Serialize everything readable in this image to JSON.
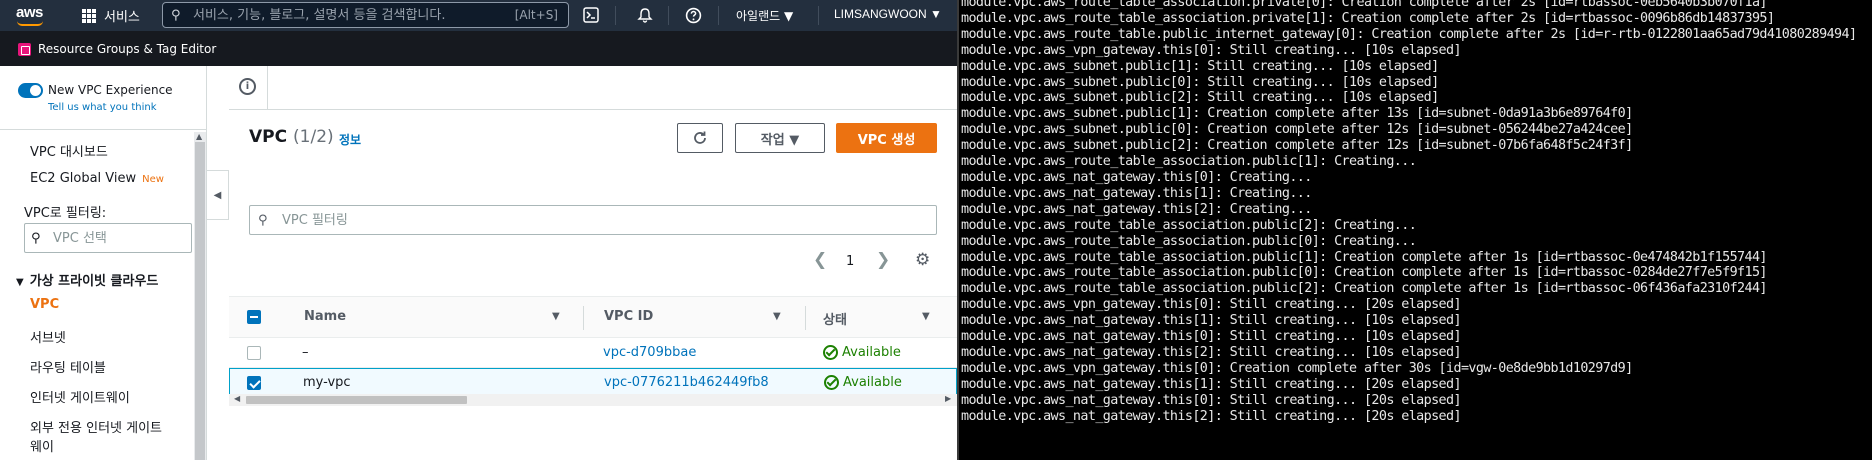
{
  "topnav": {
    "logo": "aws",
    "services_label": "서비스",
    "search_placeholder": "서비스, 기능, 블로그, 설명서 등을 검색합니다.",
    "search_shortcut": "[Alt+S]",
    "region": "아일랜드 ▼",
    "user": "LIMSANGWOON ▼",
    "icons": [
      "grid-icon",
      "search-icon",
      "cloudshell-icon",
      "bell-icon",
      "help-icon"
    ]
  },
  "subnav": {
    "resource_groups": "Resource Groups & Tag Editor"
  },
  "sidebar": {
    "new_experience": "New VPC Experience",
    "tell_us": "Tell us what you think",
    "links": [
      "VPC 대시보드",
      "EC2 Global View"
    ],
    "new_badge": "New",
    "filter_label": "VPC로 필터링:",
    "filter_placeholder": "VPC 선택",
    "section": "가상 프라이빗 클라우드",
    "items": [
      "VPC",
      "서브넷",
      "라우팅 테이블",
      "인터넷 게이트웨이",
      "외부 전용 인터넷 게이트",
      "웨이"
    ]
  },
  "main": {
    "title": "VPC",
    "count": "(1/2)",
    "info": "정보",
    "actions_label": "작업 ▼",
    "create_label": "VPC 생성",
    "filter_placeholder": "VPC 필터링",
    "page": "1",
    "columns": [
      "Name",
      "VPC ID",
      "상태"
    ],
    "rows": [
      {
        "name": "–",
        "vpc_id": "vpc-d709bbae",
        "state": "Available",
        "selected": false
      },
      {
        "name": "my-vpc",
        "vpc_id": "vpc-0776211b462449fb8",
        "state": "Available",
        "selected": true
      }
    ]
  },
  "terminal": {
    "lines": [
      "module.vpc.aws_route_table_association.private[0]: Creation complete after 2s [id=rtbassoc-0eb5640b3b070f1a]",
      "module.vpc.aws_route_table_association.private[1]: Creation complete after 2s [id=rtbassoc-0096b86db14837395]",
      "module.vpc.aws_route_table.public_internet_gateway[0]: Creation complete after 2s [id=r-rtb-0122801aa65ad79d41080289494]",
      "module.vpc.aws_vpn_gateway.this[0]: Still creating... [10s elapsed]",
      "module.vpc.aws_subnet.public[1]: Still creating... [10s elapsed]",
      "module.vpc.aws_subnet.public[0]: Still creating... [10s elapsed]",
      "module.vpc.aws_subnet.public[2]: Still creating... [10s elapsed]",
      "module.vpc.aws_subnet.public[1]: Creation complete after 13s [id=subnet-0da91a3b6e89764f0]",
      "module.vpc.aws_subnet.public[0]: Creation complete after 12s [id=subnet-056244be27a424cee]",
      "module.vpc.aws_subnet.public[2]: Creation complete after 12s [id=subnet-07b6fa648f5c24f3f]",
      "module.vpc.aws_route_table_association.public[1]: Creating...",
      "module.vpc.aws_nat_gateway.this[0]: Creating...",
      "module.vpc.aws_nat_gateway.this[1]: Creating...",
      "module.vpc.aws_nat_gateway.this[2]: Creating...",
      "module.vpc.aws_route_table_association.public[2]: Creating...",
      "module.vpc.aws_route_table_association.public[0]: Creating...",
      "module.vpc.aws_route_table_association.public[1]: Creation complete after 1s [id=rtbassoc-0e474842b1f155744]",
      "module.vpc.aws_route_table_association.public[0]: Creation complete after 1s [id=rtbassoc-0284de27f7e5f9f15]",
      "module.vpc.aws_route_table_association.public[2]: Creation complete after 1s [id=rtbassoc-06f436afa2310f244]",
      "module.vpc.aws_vpn_gateway.this[0]: Still creating... [20s elapsed]",
      "module.vpc.aws_nat_gateway.this[1]: Still creating... [10s elapsed]",
      "module.vpc.aws_nat_gateway.this[0]: Still creating... [10s elapsed]",
      "module.vpc.aws_nat_gateway.this[2]: Still creating... [10s elapsed]",
      "module.vpc.aws_vpn_gateway.this[0]: Creation complete after 30s [id=vgw-0e8de9bb1d10297d9]",
      "module.vpc.aws_nat_gateway.this[1]: Still creating... [20s elapsed]",
      "module.vpc.aws_nat_gateway.this[0]: Still creating... [20s elapsed]",
      "module.vpc.aws_nat_gateway.this[2]: Still creating... [20s elapsed]"
    ]
  }
}
